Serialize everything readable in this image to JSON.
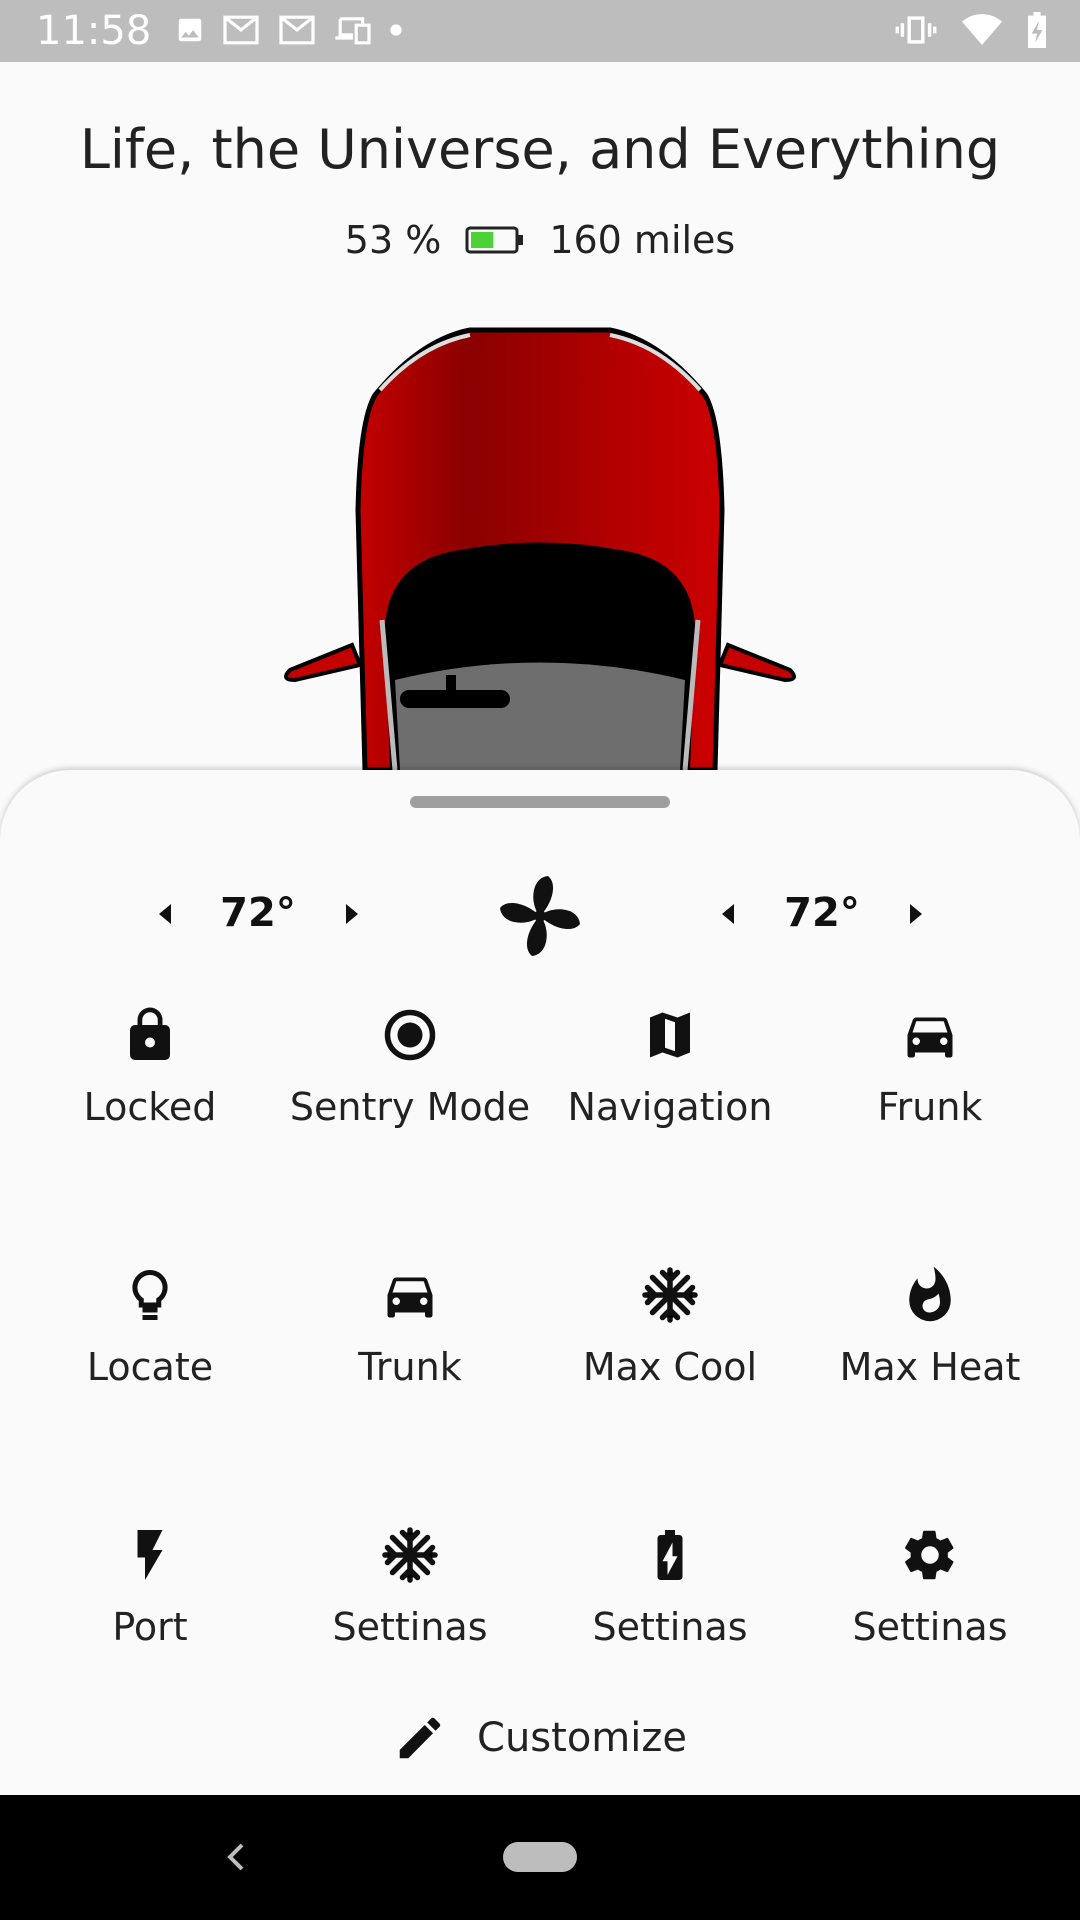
{
  "status_bar": {
    "time": "11:58",
    "left_icons": [
      "image-icon",
      "gmail-icon",
      "gmail-icon",
      "devices-icon",
      "dot-icon"
    ],
    "right_icons": [
      "vibrate-icon",
      "wifi-icon",
      "battery-charging-icon"
    ]
  },
  "vehicle": {
    "name": "Life, the Universe, and Everything",
    "battery_percent": "53 %",
    "battery_level": 0.53,
    "battery_color": "#4cd137",
    "range": "160 miles",
    "body_color": "#c40000"
  },
  "climate": {
    "driver_temp": "72°",
    "passenger_temp": "72°",
    "fan_icon": "fan-icon"
  },
  "actions": [
    {
      "label": "Locked",
      "icon": "lock-icon"
    },
    {
      "label": "Sentry Mode",
      "icon": "radio-target-icon"
    },
    {
      "label": "Navigation",
      "icon": "map-icon"
    },
    {
      "label": "Frunk",
      "icon": "car-icon"
    },
    {
      "label": "Locate",
      "icon": "lightbulb-icon"
    },
    {
      "label": "Trunk",
      "icon": "car-icon"
    },
    {
      "label": "Max Cool",
      "icon": "snowflake-icon"
    },
    {
      "label": "Max Heat",
      "icon": "fire-icon"
    },
    {
      "label": "Port",
      "icon": "lightning-icon"
    },
    {
      "label": "Settinas",
      "icon": "snowflake-icon"
    },
    {
      "label": "Settinas",
      "icon": "battery-charging-icon"
    },
    {
      "label": "Settinas",
      "icon": "gear-icon"
    }
  ],
  "customize": {
    "label": "Customize",
    "icon": "pencil-icon"
  }
}
